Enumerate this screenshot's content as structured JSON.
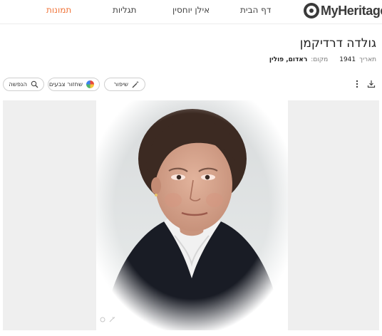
{
  "brand": {
    "name": "MyHeritage",
    "accent": "#f0763c"
  },
  "nav": [
    {
      "key": "home",
      "label": "דף הבית"
    },
    {
      "key": "tree",
      "label": "אילן יוחסין"
    },
    {
      "key": "discoveries",
      "label": "תגליות"
    },
    {
      "key": "photos",
      "label": "תמונות",
      "active": true
    }
  ],
  "photo_info": {
    "title": "גולדה דרדיקמן",
    "date_label": "תאריך",
    "date_value": "1941",
    "place_label": "מקום:",
    "place_value": "ראדום, פולין"
  },
  "toolbar": {
    "enhance_label": "שיפור",
    "colorize_label": "שחזור צבעים",
    "animate_label": "הנפשה",
    "download_icon": "download-icon",
    "more_icon": "more-vertical-icon"
  },
  "photo": {
    "subject": "portrait-older-woman",
    "colors": {
      "hair": "#3c2a22",
      "skin": "#d9a68f",
      "clothing": "#191c25",
      "collar": "#f1f1f1"
    }
  }
}
